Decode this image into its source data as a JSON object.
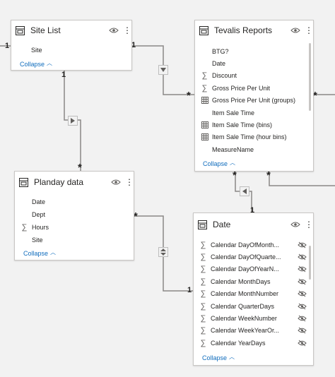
{
  "tables": {
    "site_list": {
      "title": "Site List",
      "fields": [
        {
          "name": "Site",
          "icon": "none"
        }
      ],
      "collapse": "Collapse"
    },
    "tevalis": {
      "title": "Tevalis Reports",
      "fields": [
        {
          "name": "BTG?",
          "icon": "none"
        },
        {
          "name": "Date",
          "icon": "none"
        },
        {
          "name": "Discount",
          "icon": "sigma"
        },
        {
          "name": "Gross Price Per Unit",
          "icon": "sigma"
        },
        {
          "name": "Gross Price Per Unit (groups)",
          "icon": "grid"
        },
        {
          "name": "Item Sale Time",
          "icon": "none"
        },
        {
          "name": "Item Sale Time (bins)",
          "icon": "grid"
        },
        {
          "name": "Item Sale Time (hour bins)",
          "icon": "grid"
        },
        {
          "name": "MeasureName",
          "icon": "none"
        }
      ],
      "collapse": "Collapse"
    },
    "planday": {
      "title": "Planday data",
      "fields": [
        {
          "name": "Date",
          "icon": "none"
        },
        {
          "name": "Dept",
          "icon": "none"
        },
        {
          "name": "Hours",
          "icon": "sigma"
        },
        {
          "name": "Site",
          "icon": "none"
        }
      ],
      "collapse": "Collapse"
    },
    "date": {
      "title": "Date",
      "fields": [
        {
          "name": "Calendar DayOfMonth...",
          "icon": "sigma",
          "hidden": true
        },
        {
          "name": "Calendar DayOfQuarte...",
          "icon": "sigma",
          "hidden": true
        },
        {
          "name": "Calendar DayOfYearN...",
          "icon": "sigma",
          "hidden": true
        },
        {
          "name": "Calendar MonthDays",
          "icon": "sigma",
          "hidden": true
        },
        {
          "name": "Calendar MonthNumber",
          "icon": "sigma",
          "hidden": true
        },
        {
          "name": "Calendar QuarterDays",
          "icon": "sigma",
          "hidden": true
        },
        {
          "name": "Calendar WeekNumber",
          "icon": "sigma",
          "hidden": true
        },
        {
          "name": "Calendar WeekYearOr...",
          "icon": "sigma",
          "hidden": true
        },
        {
          "name": "Calendar YearDays",
          "icon": "sigma",
          "hidden": true
        }
      ],
      "collapse": "Collapse"
    }
  },
  "relationships": {
    "site_to_tevalis": {
      "from_card": "1",
      "to_card": "*"
    },
    "site_to_planday": {
      "from_card": "1",
      "to_card": "*"
    },
    "planday_to_date": {
      "from_card": "*",
      "to_card": "1"
    },
    "tevalis_to_date": {
      "from_card": "*",
      "to_card": "1"
    },
    "tevalis_left_edge": {
      "from_card": "1"
    },
    "tevalis_right_out": {
      "card": "*"
    },
    "tevalis_bottom_right": {
      "card": "*"
    }
  },
  "colors": {
    "link": "#0f6cbd",
    "line": "#8a8886",
    "card_border": "#c8c6c4",
    "canvas": "#f2f2f2"
  }
}
